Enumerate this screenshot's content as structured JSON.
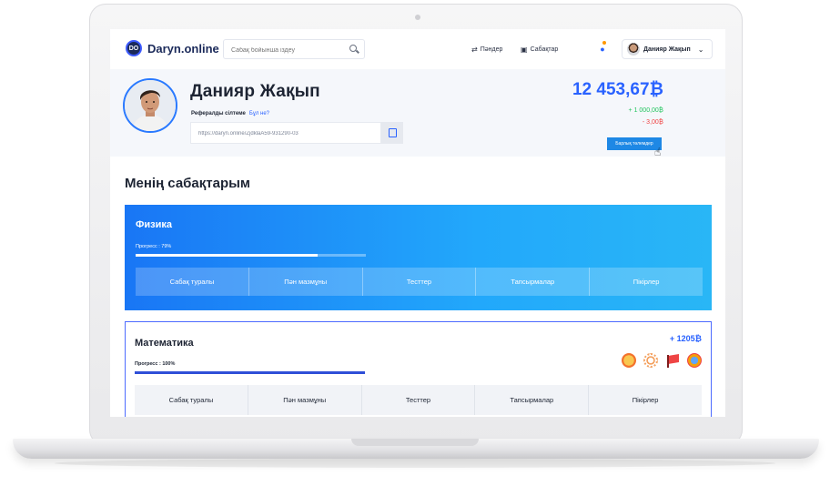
{
  "nav": {
    "logo_mark": "DO",
    "logo_text": "Daryn.online",
    "search_placeholder": "Сабақ бойынша іздеу",
    "subjects_label": "Пәндер",
    "lessons_label": "Сабақтар",
    "user_name": "Данияр Жақып"
  },
  "profile": {
    "name": "Данияр Жақып",
    "referral_label": "Рефералды сілтеме",
    "referral_help": "Бұл не?",
    "referral_link": "https://daryn.online/ZjdklaA59-931290-03",
    "balance": "12 453,67₿",
    "income": "+ 1 000,00₿",
    "expense": "- 3,00₿",
    "payments_button": "Барлық төлемдер"
  },
  "main": {
    "section_title": "Менің сабақтарым",
    "courses": [
      {
        "title": "Физика",
        "progress_label": "Прогресс : 79%",
        "progress": 0.79,
        "tabs": [
          "Сабақ туралы",
          "Пән мазмұны",
          "Тесттер",
          "Тапсырмалар",
          "Пікірлер"
        ]
      },
      {
        "title": "Математика",
        "progress_label": "Прогресс : 100%",
        "progress": 1.0,
        "reward": "+ 1205₿",
        "badges": [
          "medal-icon",
          "laurel-star-icon",
          "flag-icon",
          "rosette-icon"
        ],
        "tabs": [
          "Сабақ туралы",
          "Пән мазмұны",
          "Тесттер",
          "Тапсырмалар",
          "Пікірлер"
        ]
      }
    ]
  },
  "colors": {
    "accent": "#2962ff",
    "physics_gradient_start": "#1976f5",
    "physics_gradient_end": "#29b6f6",
    "positive": "#22c55e",
    "negative": "#ef4444"
  }
}
